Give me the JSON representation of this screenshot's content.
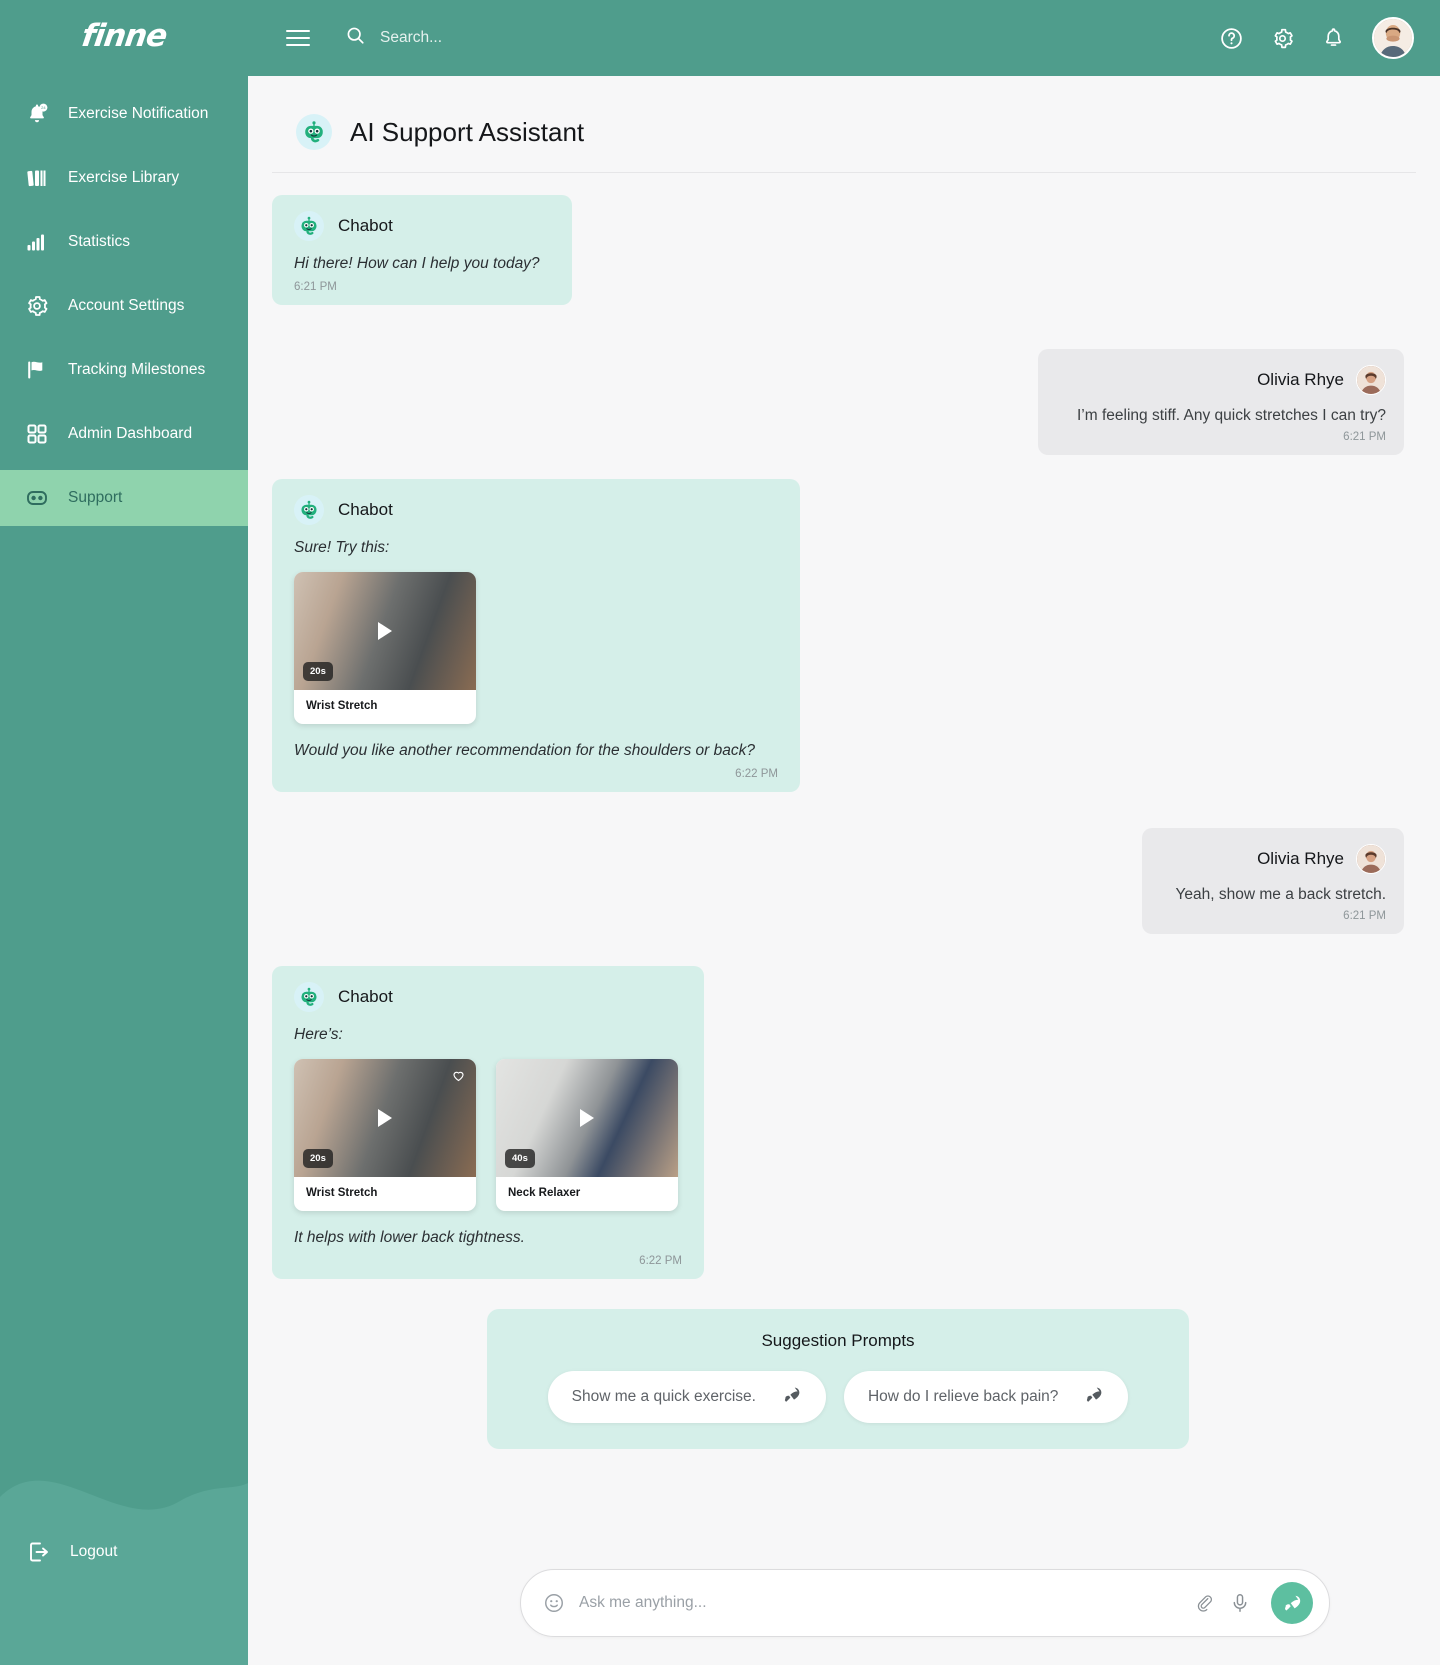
{
  "brand": {
    "name": "finne"
  },
  "sidebar": {
    "items": [
      {
        "label": "Exercise Notification",
        "icon": "bell-notification-icon",
        "active": false
      },
      {
        "label": "Exercise Library",
        "icon": "books-icon",
        "active": false
      },
      {
        "label": "Statistics",
        "icon": "bar-chart-icon",
        "active": false
      },
      {
        "label": "Account Settings",
        "icon": "gear-icon",
        "active": false
      },
      {
        "label": "Tracking Milestones",
        "icon": "flag-icon",
        "active": false
      },
      {
        "label": "Admin Dashboard",
        "icon": "grid-icon",
        "active": false
      },
      {
        "label": "Support",
        "icon": "chat-bot-icon",
        "active": true
      }
    ],
    "logout": {
      "label": "Logout",
      "icon": "logout-icon"
    }
  },
  "topbar": {
    "menu_icon": "hamburger-icon",
    "search": {
      "placeholder": "Search...",
      "value": "",
      "icon": "search-icon"
    },
    "help_icon": "help-circle-icon",
    "settings_icon": "gear-icon",
    "notifications_icon": "bell-icon",
    "avatar": "user-avatar"
  },
  "page": {
    "title": "AI Support Assistant",
    "title_icon": "robot-avatar-icon"
  },
  "conversation": [
    {
      "role": "bot",
      "sender": "Chabot",
      "text": "Hi there! How can I help you today?",
      "time": "6:21 PM",
      "cards": [],
      "text_after": ""
    },
    {
      "role": "user",
      "sender": "Olivia Rhye",
      "text": "I’m feeling stiff. Any quick stretches I can try?",
      "time": "6:21 PM"
    },
    {
      "role": "bot",
      "sender": "Chabot",
      "text": "Sure! Try this:",
      "time": "6:22 PM",
      "cards": [
        {
          "title": "Wrist Stretch",
          "duration": "20s",
          "play_icon": "play-icon",
          "favorite": false
        }
      ],
      "text_after": "Would you like another recommendation for the shoulders or back?"
    },
    {
      "role": "user",
      "sender": "Olivia Rhye",
      "text": "Yeah, show me a back stretch.",
      "time": "6:21 PM"
    },
    {
      "role": "bot",
      "sender": "Chabot",
      "text": "Here’s:",
      "time": "6:22 PM",
      "cards": [
        {
          "title": "Wrist Stretch",
          "duration": "20s",
          "play_icon": "play-icon",
          "favorite": true
        },
        {
          "title": "Neck Relaxer",
          "duration": "40s",
          "play_icon": "play-icon",
          "favorite": false
        }
      ],
      "text_after": "It helps with lower back tightness."
    }
  ],
  "suggestions": {
    "title": "Suggestion Prompts",
    "prompts": [
      {
        "label": "Show me a quick exercise.",
        "icon": "rocket-icon"
      },
      {
        "label": "How do I relieve back pain?",
        "icon": "rocket-icon"
      }
    ]
  },
  "composer": {
    "emoji_icon": "smiley-icon",
    "placeholder": "Ask me anything...",
    "value": "",
    "attach_icon": "paperclip-icon",
    "mic_icon": "microphone-icon",
    "send_icon": "send-icon"
  },
  "colors": {
    "brand_green": "#4f9d8c",
    "active_green": "#8fd3ad",
    "bot_bubble": "#d5efe9",
    "user_bubble": "#e9e9eb",
    "send_button": "#5dbfa0"
  }
}
